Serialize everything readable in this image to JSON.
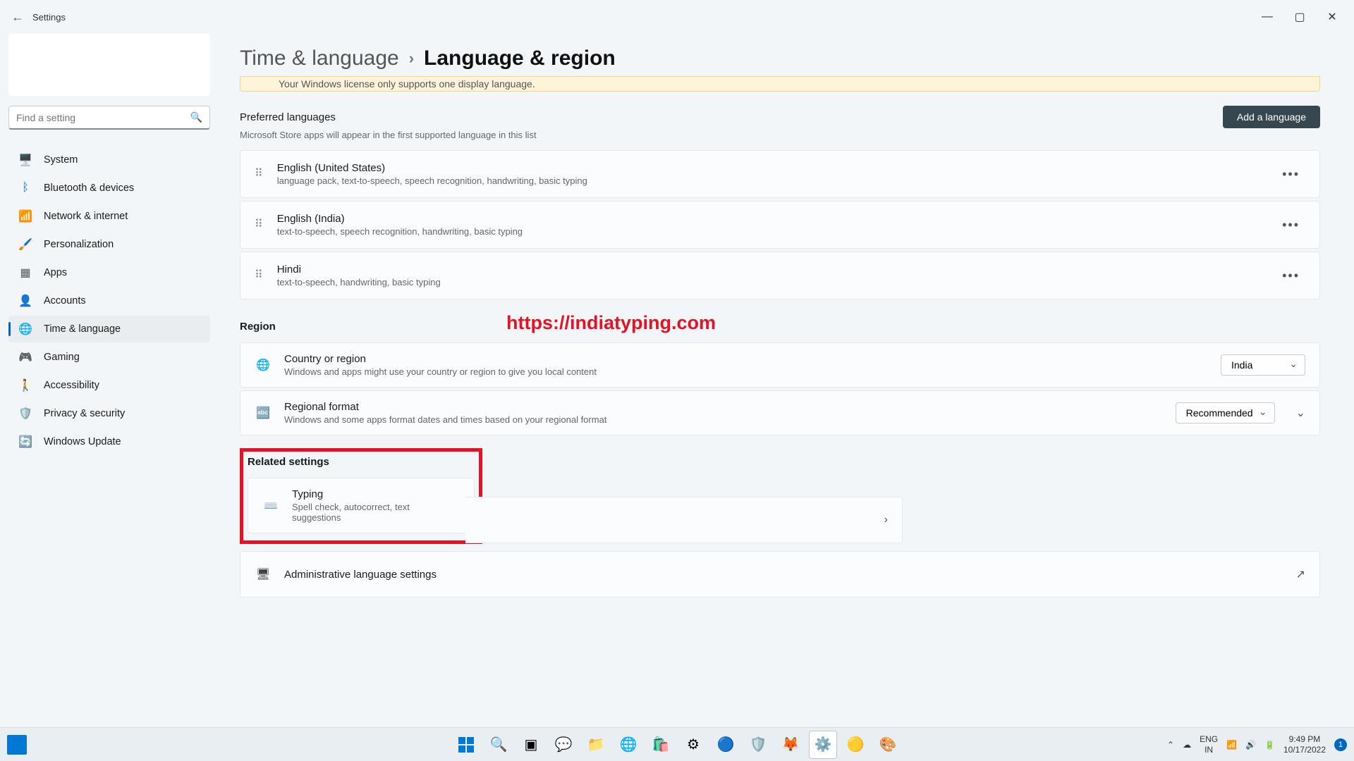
{
  "window": {
    "back_icon": "←",
    "title": "Settings"
  },
  "search": {
    "placeholder": "Find a setting"
  },
  "nav": [
    {
      "icon": "🖥️",
      "label": "System"
    },
    {
      "icon": "ᛒ",
      "label": "Bluetooth & devices",
      "iconColor": "#0078d4"
    },
    {
      "icon": "📶",
      "label": "Network & internet",
      "iconColor": "#0099e5"
    },
    {
      "icon": "🖌️",
      "label": "Personalization"
    },
    {
      "icon": "▦",
      "label": "Apps",
      "iconColor": "#555"
    },
    {
      "icon": "👤",
      "label": "Accounts",
      "iconColor": "#2e7d32"
    },
    {
      "icon": "🌐",
      "label": "Time & language",
      "active": true
    },
    {
      "icon": "🎮",
      "label": "Gaming",
      "iconColor": "#888"
    },
    {
      "icon": "🚶",
      "label": "Accessibility",
      "iconColor": "#0067c0"
    },
    {
      "icon": "🛡️",
      "label": "Privacy & security",
      "iconColor": "#888"
    },
    {
      "icon": "🔄",
      "label": "Windows Update",
      "iconColor": "#0067c0"
    }
  ],
  "breadcrumb": {
    "parent": "Time & language",
    "chev": "›",
    "current": "Language & region"
  },
  "warning": "Your Windows license only supports one display language.",
  "preferred": {
    "title": "Preferred languages",
    "sub": "Microsoft Store apps will appear in the first supported language in this list",
    "add_btn": "Add a language"
  },
  "languages": [
    {
      "name": "English (United States)",
      "detail": "language pack, text-to-speech, speech recognition, handwriting, basic typing"
    },
    {
      "name": "English (India)",
      "detail": "text-to-speech, speech recognition, handwriting, basic typing"
    },
    {
      "name": "Hindi",
      "detail": "text-to-speech, handwriting, basic typing"
    }
  ],
  "region_label": "Region",
  "region": {
    "country": {
      "title": "Country or region",
      "sub": "Windows and apps might use your country or region to give you local content",
      "value": "India"
    },
    "format": {
      "title": "Regional format",
      "sub": "Windows and some apps format dates and times based on your regional format",
      "value": "Recommended"
    }
  },
  "related": {
    "label": "Related settings",
    "typing": {
      "title": "Typing",
      "sub": "Spell check, autocorrect, text suggestions"
    },
    "admin": "Administrative language settings"
  },
  "watermark": "https://indiatyping.com",
  "systray": {
    "lang1": "ENG",
    "lang2": "IN",
    "time": "9:49 PM",
    "date": "10/17/2022",
    "badge": "1"
  }
}
